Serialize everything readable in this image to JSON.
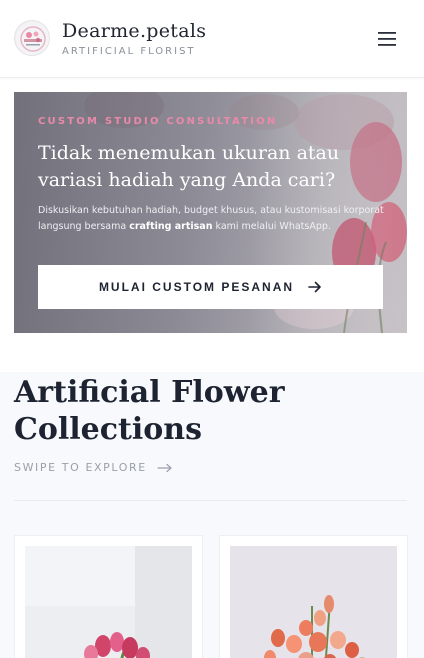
{
  "header": {
    "brand_name": "Dearme.petals",
    "brand_tagline": "ARTIFICIAL FLORIST",
    "logo_icon": "dearme-petals-logo",
    "menu_icon": "hamburger-menu-icon"
  },
  "hero": {
    "eyebrow": "CUSTOM STUDIO CONSULTATION",
    "title": "Tidak menemukan ukuran atau variasi hadiah yang Anda cari?",
    "description_before": "Diskusikan kebutuhan hadiah, budget khusus, atau kustomisasi korporat langsung bersama ",
    "description_bold": "crafting artisan",
    "description_after": " kami melalui WhatsApp.",
    "cta_label": "MULAI CUSTOM PESANAN",
    "cta_icon": "arrow-right-icon",
    "colors": {
      "eyebrow": "#e98aa8",
      "overlay": "#8d8c96"
    }
  },
  "collections": {
    "title": "Artificial Flower Collections",
    "swipe_label": "SWIPE TO EXPLORE",
    "swipe_icon": "arrow-right-icon",
    "cards": [
      {
        "image": "pink-tulip-bouquet-photo"
      },
      {
        "image": "orange-peach-flower-bouquet-photo"
      }
    ]
  }
}
